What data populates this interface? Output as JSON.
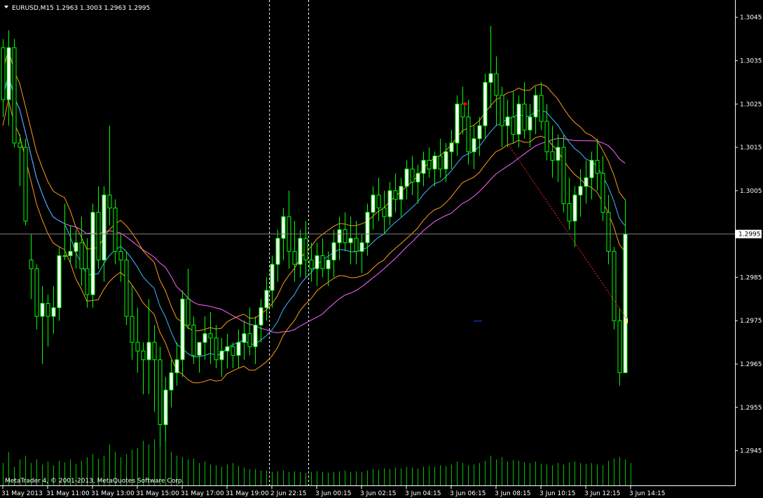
{
  "header": {
    "title": "EURUSD,M15  1.2963 1.3003 1.2963 1.2995"
  },
  "copyright": "MetaTrader 4, © 2001-2013, MetaQuotes Software Corp.",
  "colors": {
    "background": "#000000",
    "grid_axis": "#ffffff",
    "bull_candle": "#ffffff",
    "wick": "#00ff00",
    "bear_candle_fill": "#000000",
    "volume": "#00c000",
    "ma_fast": "#3db8ff",
    "ma_band": "#ff9a1a",
    "ma_slow": "#ff66ff",
    "trendline": "#ff2020",
    "price_line": "#808080",
    "price_label_bg": "#ffffff",
    "price_label_text": "#000000",
    "arrow_marker": "#ff0000",
    "triangle_marker": "#ffff80"
  },
  "chart_data": {
    "type": "candlestick",
    "symbol": "EURUSD",
    "timeframe": "M15",
    "ohlc_header": {
      "open": 1.2963,
      "high": 1.3003,
      "low": 1.2963,
      "close": 1.2995
    },
    "current_price": "1.2995",
    "ylim": [
      1.2937,
      1.3049
    ],
    "y_tick_labels": [
      "1.3045",
      "1.3035",
      "1.3025",
      "1.3015",
      "1.3005",
      "1.2995",
      "1.2985",
      "1.2975",
      "1.2965",
      "1.2955",
      "1.2945"
    ],
    "x_tick_labels": [
      {
        "label": "31 May 2013",
        "bar": 0
      },
      {
        "label": "31 May 11:00",
        "bar": 8
      },
      {
        "label": "31 May 13:00",
        "bar": 16
      },
      {
        "label": "31 May 15:00",
        "bar": 24
      },
      {
        "label": "31 May 17:00",
        "bar": 32
      },
      {
        "label": "31 May 19:00",
        "bar": 40
      },
      {
        "label": "2 Jun 22:15",
        "bar": 48
      },
      {
        "label": "3 Jun 00:15",
        "bar": 56
      },
      {
        "label": "3 Jun 02:15",
        "bar": 64
      },
      {
        "label": "3 Jun 04:15",
        "bar": 72
      },
      {
        "label": "3 Jun 06:15",
        "bar": 80
      },
      {
        "label": "3 Jun 08:15",
        "bar": 88
      },
      {
        "label": "3 Jun 10:15",
        "bar": 96
      },
      {
        "label": "3 Jun 12:15",
        "bar": 104
      },
      {
        "label": "3 Jun 14:15",
        "bar": 112
      }
    ],
    "period_separators": [
      48,
      55
    ],
    "candles": [
      [
        1.3038,
        1.304,
        1.3022,
        1.3026
      ],
      [
        1.3026,
        1.3042,
        1.302,
        1.3038
      ],
      [
        1.3038,
        1.304,
        1.3015,
        1.3016
      ],
      [
        1.3016,
        1.3018,
        1.3006,
        1.3015
      ],
      [
        1.3015,
        1.3017,
        1.2997,
        1.2998
      ],
      [
        1.2989,
        1.2995,
        1.298,
        1.2987
      ],
      [
        1.2987,
        1.2988,
        1.2973,
        1.2976
      ],
      [
        1.2976,
        1.2983,
        1.2965,
        1.2979
      ],
      [
        1.2979,
        1.2981,
        1.2969,
        1.2976
      ],
      [
        1.2976,
        1.2983,
        1.2972,
        1.2978
      ],
      [
        1.2978,
        1.2992,
        1.2975,
        1.299
      ],
      [
        1.299,
        1.3002,
        1.2989,
        1.299
      ],
      [
        1.299,
        1.2997,
        1.2988,
        1.2991
      ],
      [
        1.2991,
        1.2996,
        1.2987,
        1.2993
      ],
      [
        1.2993,
        1.2999,
        1.2983,
        1.2987
      ],
      [
        1.2987,
        1.2994,
        1.2978,
        1.2981
      ],
      [
        1.2981,
        1.3002,
        1.2978,
        1.3
      ],
      [
        1.3,
        1.3006,
        1.2987,
        1.2989
      ],
      [
        1.2989,
        1.3006,
        1.2984,
        1.3004
      ],
      [
        1.3004,
        1.302,
        1.2997,
        1.3001
      ],
      [
        1.3001,
        1.3003,
        1.2988,
        1.2991
      ],
      [
        1.2991,
        1.2995,
        1.2984,
        1.2989
      ],
      [
        1.2989,
        1.2991,
        1.2974,
        1.2976
      ],
      [
        1.2976,
        1.2983,
        1.2966,
        1.297
      ],
      [
        1.297,
        1.2978,
        1.2963,
        1.2968
      ],
      [
        1.2968,
        1.297,
        1.2958,
        1.2966
      ],
      [
        1.2966,
        1.298,
        1.2958,
        1.297
      ],
      [
        1.297,
        1.2974,
        1.2954,
        1.2966
      ],
      [
        1.2966,
        1.2969,
        1.2946,
        1.2951
      ],
      [
        1.2951,
        1.2962,
        1.2947,
        1.2959
      ],
      [
        1.2959,
        1.2966,
        1.2955,
        1.2963
      ],
      [
        1.2963,
        1.297,
        1.296,
        1.2966
      ],
      [
        1.2966,
        1.2982,
        1.2962,
        1.298
      ],
      [
        1.298,
        1.2987,
        1.2973,
        1.2974
      ],
      [
        1.2974,
        1.2976,
        1.2965,
        1.2967
      ],
      [
        1.2967,
        1.297,
        1.2963,
        1.297
      ],
      [
        1.297,
        1.2976,
        1.2966,
        1.2972
      ],
      [
        1.2972,
        1.2977,
        1.2965,
        1.2971
      ],
      [
        1.2971,
        1.2974,
        1.2964,
        1.2966
      ],
      [
        1.2966,
        1.2971,
        1.2962,
        1.2968
      ],
      [
        1.2968,
        1.2972,
        1.2964,
        1.2969
      ],
      [
        1.2969,
        1.297,
        1.2964,
        1.2967
      ],
      [
        1.2967,
        1.2973,
        1.2964,
        1.297
      ],
      [
        1.297,
        1.2975,
        1.2966,
        1.2972
      ],
      [
        1.2972,
        1.2978,
        1.2967,
        1.2969
      ],
      [
        1.2969,
        1.2976,
        1.2965,
        1.2974
      ],
      [
        1.2974,
        1.298,
        1.297,
        1.2978
      ],
      [
        1.2978,
        1.2985,
        1.2975,
        1.2982
      ],
      [
        1.2982,
        1.299,
        1.2978,
        1.2988
      ],
      [
        1.2988,
        1.2996,
        1.2984,
        1.2994
      ],
      [
        1.2994,
        1.3001,
        1.2989,
        1.2999
      ],
      [
        1.2999,
        1.3005,
        1.2987,
        1.2991
      ],
      [
        1.2991,
        1.2998,
        1.2984,
        1.2988
      ],
      [
        1.2988,
        1.2996,
        1.2985,
        1.2994
      ],
      [
        1.2994,
        1.2998,
        1.2985,
        1.2989
      ],
      [
        1.2989,
        1.2993,
        1.2984,
        1.2987
      ],
      [
        1.2987,
        1.2993,
        1.2983,
        1.299
      ],
      [
        1.299,
        1.2994,
        1.2985,
        1.2987
      ],
      [
        1.2987,
        1.2991,
        1.2983,
        1.2989
      ],
      [
        1.2989,
        1.2996,
        1.2985,
        1.2993
      ],
      [
        1.2993,
        1.2999,
        1.2989,
        1.2996
      ],
      [
        1.2996,
        1.3,
        1.2991,
        1.2993
      ],
      [
        1.2993,
        1.2999,
        1.2988,
        1.2994
      ],
      [
        1.2994,
        1.2998,
        1.2988,
        1.2991
      ],
      [
        1.2991,
        1.2995,
        1.2986,
        1.2993
      ],
      [
        1.2993,
        1.3002,
        1.299,
        1.3
      ],
      [
        1.3,
        1.3006,
        1.2996,
        1.3004
      ],
      [
        1.3004,
        1.3008,
        1.2998,
        1.3001
      ],
      [
        1.3001,
        1.3005,
        1.2995,
        1.2999
      ],
      [
        1.2999,
        1.3007,
        1.2997,
        1.3005
      ],
      [
        1.3005,
        1.3009,
        1.3,
        1.3003
      ],
      [
        1.3003,
        1.3008,
        1.2999,
        1.3006
      ],
      [
        1.3006,
        1.3012,
        1.3003,
        1.301
      ],
      [
        1.301,
        1.3013,
        1.3004,
        1.3007
      ],
      [
        1.3007,
        1.3011,
        1.3002,
        1.3009
      ],
      [
        1.3009,
        1.3014,
        1.3006,
        1.3012
      ],
      [
        1.3012,
        1.3015,
        1.3008,
        1.301
      ],
      [
        1.301,
        1.3014,
        1.3006,
        1.3013
      ],
      [
        1.3013,
        1.3017,
        1.3008,
        1.301
      ],
      [
        1.301,
        1.3016,
        1.3007,
        1.3014
      ],
      [
        1.3014,
        1.3019,
        1.301,
        1.3016
      ],
      [
        1.3016,
        1.3027,
        1.3013,
        1.3025
      ],
      [
        1.3025,
        1.3029,
        1.3018,
        1.3022
      ],
      [
        1.3022,
        1.3026,
        1.3011,
        1.3014
      ],
      [
        1.3014,
        1.302,
        1.301,
        1.3017
      ],
      [
        1.3017,
        1.3022,
        1.3013,
        1.302
      ],
      [
        1.302,
        1.3032,
        1.3017,
        1.303
      ],
      [
        1.303,
        1.3043,
        1.3024,
        1.3032
      ],
      [
        1.3032,
        1.3036,
        1.302,
        1.3027
      ],
      [
        1.3027,
        1.3029,
        1.3015,
        1.302
      ],
      [
        1.302,
        1.3026,
        1.3015,
        1.3022
      ],
      [
        1.3022,
        1.3028,
        1.3016,
        1.3018
      ],
      [
        1.3018,
        1.3027,
        1.3015,
        1.3025
      ],
      [
        1.3025,
        1.303,
        1.3017,
        1.3019
      ],
      [
        1.3019,
        1.3025,
        1.3015,
        1.3022
      ],
      [
        1.3022,
        1.3029,
        1.3018,
        1.3027
      ],
      [
        1.3027,
        1.303,
        1.3019,
        1.3021
      ],
      [
        1.3021,
        1.3025,
        1.3012,
        1.3014
      ],
      [
        1.3014,
        1.302,
        1.3008,
        1.3012
      ],
      [
        1.3012,
        1.3018,
        1.3007,
        1.3015
      ],
      [
        1.3015,
        1.3018,
        1.3,
        1.3002
      ],
      [
        1.3002,
        1.3008,
        1.2996,
        1.2998
      ],
      [
        1.2998,
        1.3006,
        1.2992,
        1.3004
      ],
      [
        1.3004,
        1.301,
        1.2999,
        1.3006
      ],
      [
        1.3006,
        1.3012,
        1.3002,
        1.3008
      ],
      [
        1.3008,
        1.3014,
        1.3003,
        1.3012
      ],
      [
        1.3012,
        1.3017,
        1.3005,
        1.3009
      ],
      [
        1.3009,
        1.3013,
        1.2998,
        1.3
      ],
      [
        1.3,
        1.3004,
        1.2988,
        1.2991
      ],
      [
        1.2991,
        1.2992,
        1.2973,
        1.2975
      ],
      [
        1.2975,
        1.2978,
        1.296,
        1.2963
      ],
      [
        1.2963,
        1.3003,
        1.2963,
        1.2995
      ]
    ],
    "volumes": [
      30,
      45,
      25,
      35,
      40,
      30,
      35,
      28,
      32,
      27,
      33,
      31,
      35,
      29,
      33,
      38,
      42,
      36,
      40,
      55,
      45,
      38,
      42,
      48,
      50,
      60,
      55,
      62,
      66,
      58,
      45,
      40,
      38,
      35,
      36,
      30,
      32,
      28,
      27,
      25,
      28,
      30,
      26,
      24,
      22,
      22,
      20,
      20,
      18,
      19,
      20,
      18,
      19,
      18,
      17,
      18,
      19,
      18,
      17,
      18,
      19,
      20,
      18,
      19,
      18,
      20,
      22,
      21,
      23,
      22,
      24,
      23,
      25,
      24,
      23,
      25,
      26,
      25,
      27,
      26,
      28,
      32,
      30,
      27,
      28,
      30,
      33,
      40,
      35,
      38,
      32,
      34,
      33,
      31,
      30,
      32,
      29,
      28,
      27,
      30,
      28,
      31,
      32,
      30,
      29,
      30,
      28,
      27,
      33,
      36,
      38,
      35,
      30
    ]
  }
}
